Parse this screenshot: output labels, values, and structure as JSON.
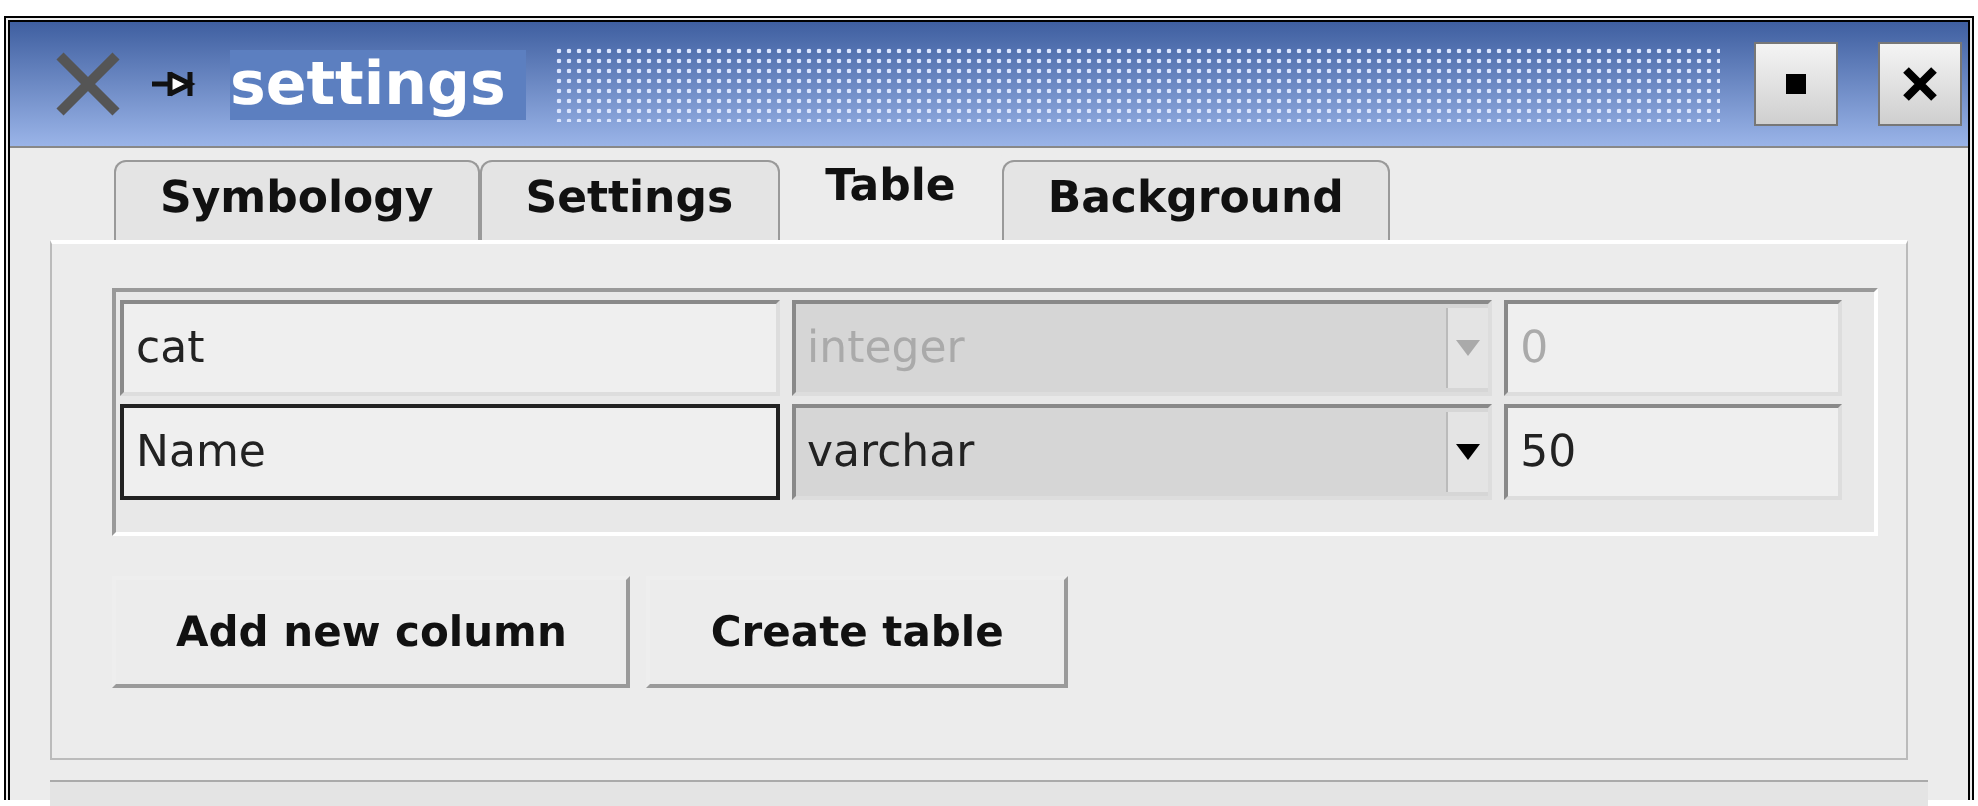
{
  "window": {
    "title": "settings"
  },
  "tabs": [
    {
      "label": "Symbology",
      "selected": false
    },
    {
      "label": "Settings",
      "selected": false
    },
    {
      "label": "Table",
      "selected": true
    },
    {
      "label": "Background",
      "selected": false
    }
  ],
  "columns": [
    {
      "name": "cat",
      "type": "integer",
      "size": "0",
      "disabled": true,
      "focused": false
    },
    {
      "name": "Name",
      "type": "varchar",
      "size": "50",
      "disabled": false,
      "focused": true
    }
  ],
  "buttons": [
    "Add new column",
    "Create table"
  ]
}
